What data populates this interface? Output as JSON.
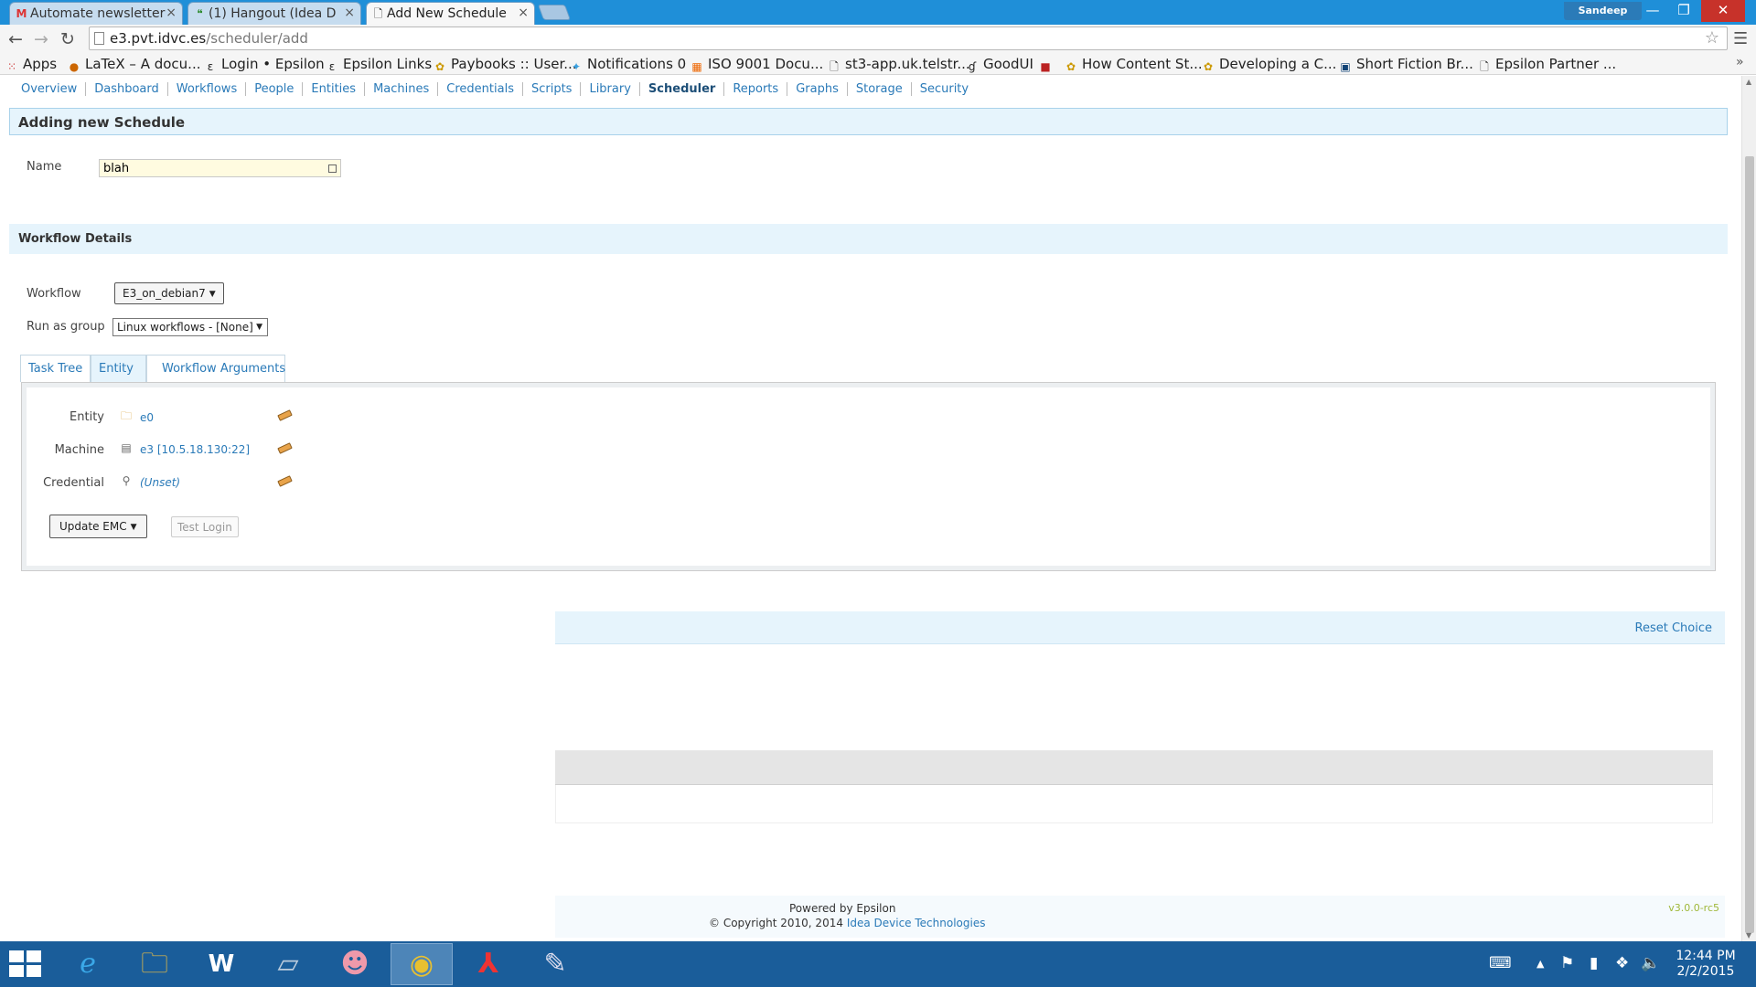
{
  "browser": {
    "tabs": [
      {
        "title": "Automate newsletter",
        "favicon": "gmail-icon"
      },
      {
        "title": "(1) Hangout (Idea D",
        "favicon": "hangout-icon"
      },
      {
        "title": "Add New Schedule",
        "favicon": "page-icon"
      }
    ],
    "user_badge": "Sandeep",
    "url_host": "e3.pvt.idvc.es",
    "url_path": "/scheduler/add",
    "bookmarks": [
      "Apps",
      "LaTeX – A docu...",
      "Login • Epsilon",
      "Epsilon Links",
      "Paybooks :: User...",
      "Notifications 0",
      "ISO 9001 Docu...",
      "st3-app.uk.telstr...",
      "GoodUI",
      "How Content St...",
      "Developing a C...",
      "Short Fiction Br...",
      "Epsilon Partner ..."
    ]
  },
  "nav": {
    "items": [
      "Overview",
      "Dashboard",
      "Workflows",
      "People",
      "Entities",
      "Machines",
      "Credentials",
      "Scripts",
      "Library",
      "Scheduler",
      "Reports",
      "Graphs",
      "Storage",
      "Security"
    ],
    "active": "Scheduler"
  },
  "form": {
    "heading": "Adding new Schedule",
    "name_label": "Name",
    "name_value": "blah",
    "workflow_details_heading": "Workflow Details",
    "workflow_label": "Workflow",
    "workflow_value": "E3_on_debian7",
    "run_as_group_label": "Run as group",
    "run_as_group_value": "Linux workflows - [None]"
  },
  "tabs": {
    "items": [
      "Task Tree",
      "Entity",
      "Workflow Arguments"
    ],
    "active": "Entity"
  },
  "entity_panel": {
    "entity_label": "Entity",
    "entity_value": "e0",
    "machine_label": "Machine",
    "machine_value": "e3 [10.5.18.130:22]",
    "credential_label": "Credential",
    "credential_value": "(Unset)",
    "update_button": "Update EMC",
    "test_login_button": "Test Login"
  },
  "reset_choice": "Reset Choice",
  "footer": {
    "powered_by": "Powered by Epsilon",
    "copyright": "© Copyright 2010, 2014",
    "company": "Idea Device Technologies",
    "version": "v3.0.0-rc5"
  },
  "taskbar": {
    "time": "12:44 PM",
    "date": "2/2/2015"
  },
  "colors": {
    "link": "#2a7ab8",
    "section_bg": "#e6f4fc",
    "taskbar": "#1a5d9a",
    "tabstrip": "#1f8fd8"
  }
}
